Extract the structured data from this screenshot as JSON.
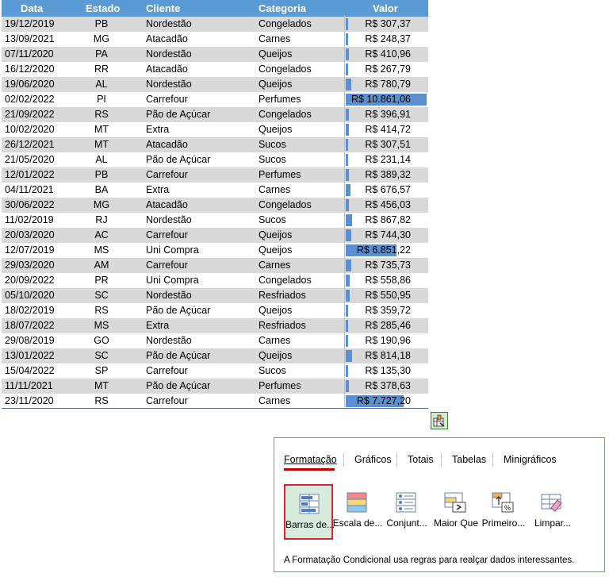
{
  "table": {
    "headers": [
      "Data",
      "Estado",
      "Cliente",
      "Categoria",
      "Valor"
    ],
    "rows": [
      [
        "19/12/2019",
        "PB",
        "Nordestão",
        "Congelados",
        "R$ 307,37"
      ],
      [
        "13/09/2021",
        "MG",
        "Atacadão",
        "Carnes",
        "R$ 248,37"
      ],
      [
        "07/11/2020",
        "PA",
        "Nordestão",
        "Queijos",
        "R$ 410,96"
      ],
      [
        "16/12/2020",
        "RR",
        "Atacadão",
        "Congelados",
        "R$ 267,79"
      ],
      [
        "19/06/2020",
        "AL",
        "Nordestão",
        "Queijos",
        "R$ 780,79"
      ],
      [
        "02/02/2022",
        "PI",
        "Carrefour",
        "Perfumes",
        "R$ 10.861,06"
      ],
      [
        "21/09/2022",
        "RS",
        "Pão de Açúcar",
        "Congelados",
        "R$ 396,91"
      ],
      [
        "10/02/2020",
        "MT",
        "Extra",
        "Queijos",
        "R$ 414,72"
      ],
      [
        "26/12/2021",
        "MT",
        "Atacadão",
        "Sucos",
        "R$ 307,51"
      ],
      [
        "21/05/2020",
        "AL",
        "Pão de Açúcar",
        "Sucos",
        "R$ 231,14"
      ],
      [
        "12/01/2022",
        "PB",
        "Carrefour",
        "Perfumes",
        "R$ 389,32"
      ],
      [
        "04/11/2021",
        "BA",
        "Extra",
        "Carnes",
        "R$ 676,57"
      ],
      [
        "30/06/2022",
        "MG",
        "Atacadão",
        "Congelados",
        "R$ 456,03"
      ],
      [
        "11/02/2019",
        "RJ",
        "Nordestão",
        "Sucos",
        "R$ 867,82"
      ],
      [
        "20/03/2020",
        "AC",
        "Carrefour",
        "Queijos",
        "R$ 744,30"
      ],
      [
        "12/07/2019",
        "MS",
        "Uni Compra",
        "Queijos",
        "R$ 6.851,22"
      ],
      [
        "29/03/2020",
        "AM",
        "Carrefour",
        "Carnes",
        "R$ 735,73"
      ],
      [
        "20/09/2022",
        "PR",
        "Uni Compra",
        "Congelados",
        "R$ 558,86"
      ],
      [
        "05/10/2020",
        "SC",
        "Nordestão",
        "Resfriados",
        "R$ 550,95"
      ],
      [
        "18/02/2019",
        "RS",
        "Pão de Açúcar",
        "Queijos",
        "R$ 359,72"
      ],
      [
        "18/07/2022",
        "MS",
        "Extra",
        "Resfriados",
        "R$ 285,46"
      ],
      [
        "29/08/2019",
        "GO",
        "Nordestão",
        "Carnes",
        "R$ 190,96"
      ],
      [
        "13/01/2022",
        "SC",
        "Pão de Açúcar",
        "Queijos",
        "R$ 814,18"
      ],
      [
        "15/04/2022",
        "SP",
        "Carrefour",
        "Sucos",
        "R$ 135,30"
      ],
      [
        "11/11/2021",
        "MT",
        "Pão de Açúcar",
        "Perfumes",
        "R$ 378,63"
      ],
      [
        "23/11/2020",
        "RS",
        "Carrefour",
        "Carnes",
        "R$ 7.727,20"
      ]
    ],
    "values_numeric": [
      307.37,
      248.37,
      410.96,
      267.79,
      780.79,
      10861.06,
      396.91,
      414.72,
      307.51,
      231.14,
      389.32,
      676.57,
      456.03,
      867.82,
      744.3,
      6851.22,
      735.73,
      558.86,
      550.95,
      359.72,
      285.46,
      190.96,
      814.18,
      135.3,
      378.63,
      7727.2
    ],
    "colors": {
      "header_bg": "#5b9bd5",
      "band_bg": "#d9d9d9",
      "data_bar": "#5b8fd0"
    }
  },
  "quick_analysis": {
    "button_icon": "quick-analysis-icon",
    "tabs": [
      "Formatação",
      "Gráficos",
      "Totais",
      "Tabelas",
      "Minigráficos"
    ],
    "active_tab": "Formatação",
    "tools": [
      {
        "label": "Barras de...",
        "icon": "data-bars-icon"
      },
      {
        "label": "Escala de...",
        "icon": "color-scale-icon"
      },
      {
        "label": "Conjunt...",
        "icon": "icon-set-icon"
      },
      {
        "label": "Maior Que",
        "icon": "greater-than-icon"
      },
      {
        "label": "Primeiro...",
        "icon": "top-percent-icon"
      },
      {
        "label": "Limpar...",
        "icon": "clear-format-icon"
      }
    ],
    "selected_tool": "Barras de...",
    "description": "A Formatação Condicional usa regras para realçar dados interessantes.",
    "accent": "#d9262e"
  }
}
